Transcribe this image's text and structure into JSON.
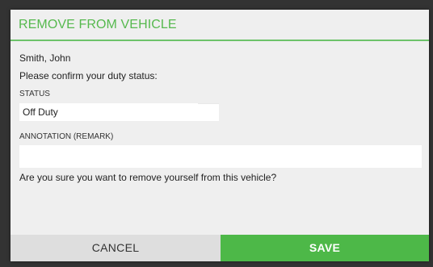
{
  "dialog": {
    "title": "REMOVE FROM VEHICLE",
    "driver_name": "Smith, John",
    "prompt": "Please confirm your duty status:",
    "status": {
      "label": "STATUS",
      "selected_value": "Off Duty"
    },
    "annotation": {
      "label": "ANNOTATION (REMARK)",
      "value": "",
      "placeholder": ""
    },
    "confirm_question": "Are you sure you want to remove yourself from this vehicle?",
    "buttons": {
      "cancel_label": "CANCEL",
      "save_label": "SAVE"
    }
  },
  "colors": {
    "accent": "#4db848",
    "title": "#56b94e",
    "cancel_bg": "#dedede",
    "dialog_bg": "#efefef"
  }
}
